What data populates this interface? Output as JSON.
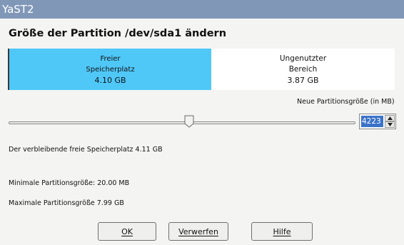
{
  "window": {
    "title": "YaST2"
  },
  "dialog": {
    "heading": "Größe der Partition /dev/sda1 ändern",
    "free_segment": {
      "line1": "Freier",
      "line2": "Speicherplatz",
      "size": "4.10 GB"
    },
    "unused_segment": {
      "line1": "Ungenutzter",
      "line2": "Bereich",
      "size": "3.87 GB"
    },
    "new_size_label": "Neue Partitionsgröße (in MB)",
    "new_size_value": "4223",
    "slider_fraction": 0.52,
    "remaining_free": "Der verbleibende freie Speicherplatz 4.11 GB",
    "min_size": "Minimale Partitionsgröße: 20.00 MB",
    "max_size": "Maximale Partitionsgröße 7.99 GB"
  },
  "buttons": {
    "ok": "OK",
    "discard": "Verwerfen",
    "help": "Hilfe"
  },
  "colors": {
    "titlebar": "#8197b7",
    "free": "#4fc8f8",
    "selection": "#3b73c8"
  }
}
